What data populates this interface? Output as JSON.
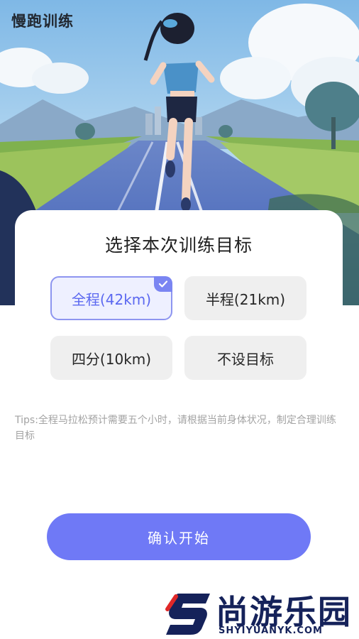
{
  "header": {
    "title": "慢跑训练"
  },
  "card": {
    "title": "选择本次训练目标"
  },
  "options": [
    {
      "label": "全程(42km)",
      "selected": true
    },
    {
      "label": "半程(21km)",
      "selected": false
    },
    {
      "label": "四分(10km)",
      "selected": false
    },
    {
      "label": "不设目标",
      "selected": false
    }
  ],
  "tips": "Tips:全程马拉松预计需要五个小时，请根据当前身体状况，制定合理训练目标",
  "confirm_label": "确认开始",
  "watermark": {
    "text": "尚游乐园",
    "url": "SHYIYUANYK.COM"
  },
  "colors": {
    "accent": "#6f79f6",
    "selected_border": "#8d95f0",
    "selected_text": "#5b68f0",
    "option_bg": "#efefef"
  },
  "icons": {
    "check": "check-icon"
  }
}
